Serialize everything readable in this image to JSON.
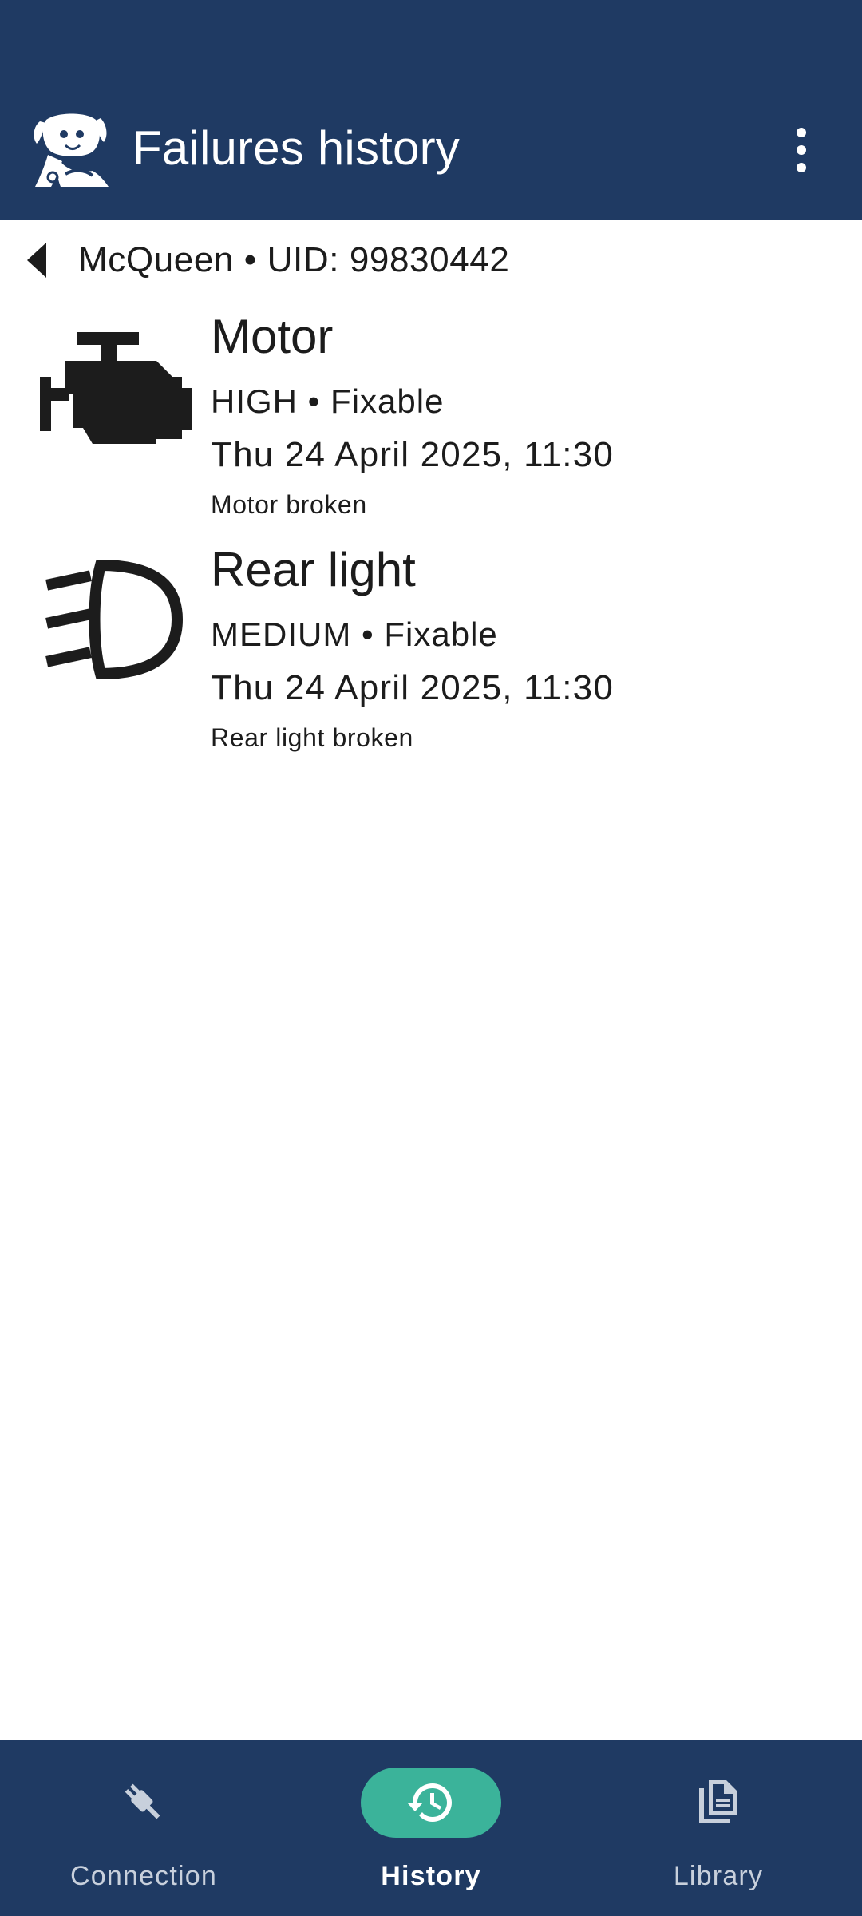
{
  "app_bar": {
    "title": "Failures history",
    "logo_icon": "dog-mascot-logo",
    "menu_icon": "more-vert-icon",
    "background": "#1f3a63"
  },
  "subheader": {
    "back_icon": "back-arrow-icon",
    "text": "McQueen • UID: 99830442"
  },
  "failures": [
    {
      "icon": "engine-icon",
      "name": "Motor",
      "meta": "HIGH • Fixable",
      "date": "Thu 24 April 2025, 11:30",
      "description": "Motor broken"
    },
    {
      "icon": "headlight-icon",
      "name": "Rear light",
      "meta": "MEDIUM • Fixable",
      "date": "Thu 24 April 2025, 11:30",
      "description": "Rear light broken"
    }
  ],
  "bottom_nav": {
    "items": [
      {
        "label": "Connection",
        "icon": "plug-icon",
        "active": false
      },
      {
        "label": "History",
        "icon": "history-icon",
        "active": true
      },
      {
        "label": "Library",
        "icon": "library-icon",
        "active": false
      }
    ],
    "active_color": "#3bb39a"
  }
}
